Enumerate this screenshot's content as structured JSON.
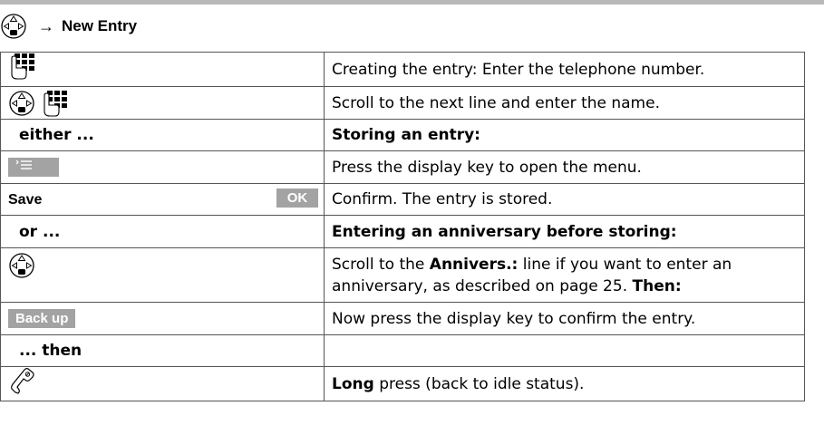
{
  "heading": {
    "arrow": "→",
    "title": "New Entry"
  },
  "rows": [
    {
      "desc": "Creating the entry: Enter the telephone number."
    },
    {
      "desc": "Scroll to the next line and enter the name."
    },
    {
      "label": "either ...",
      "desc": "Storing an entry:"
    },
    {
      "desc": "Press the display key to open the menu."
    },
    {
      "label": "Save",
      "key": "OK",
      "desc": "Confirm. The entry is stored."
    },
    {
      "label": "or ...",
      "desc": "Entering an anniversary before storing:"
    },
    {
      "desc_pre": "Scroll to the ",
      "desc_bold": "Annivers.:",
      "desc_mid": " line if you want to enter an anniversary, as described on page 25. ",
      "desc_bold2": "Then:"
    },
    {
      "label": "Back up",
      "desc": "Now press the display key to confirm the entry."
    },
    {
      "label": "... then",
      "desc": ""
    },
    {
      "desc_bold": "Long",
      "desc_post": " press (back to idle status)."
    }
  ],
  "icons": {
    "nav": "control-key-icon",
    "keypad": "keypad-icon",
    "menu": "menu-key-icon",
    "end": "end-call-key-icon"
  }
}
